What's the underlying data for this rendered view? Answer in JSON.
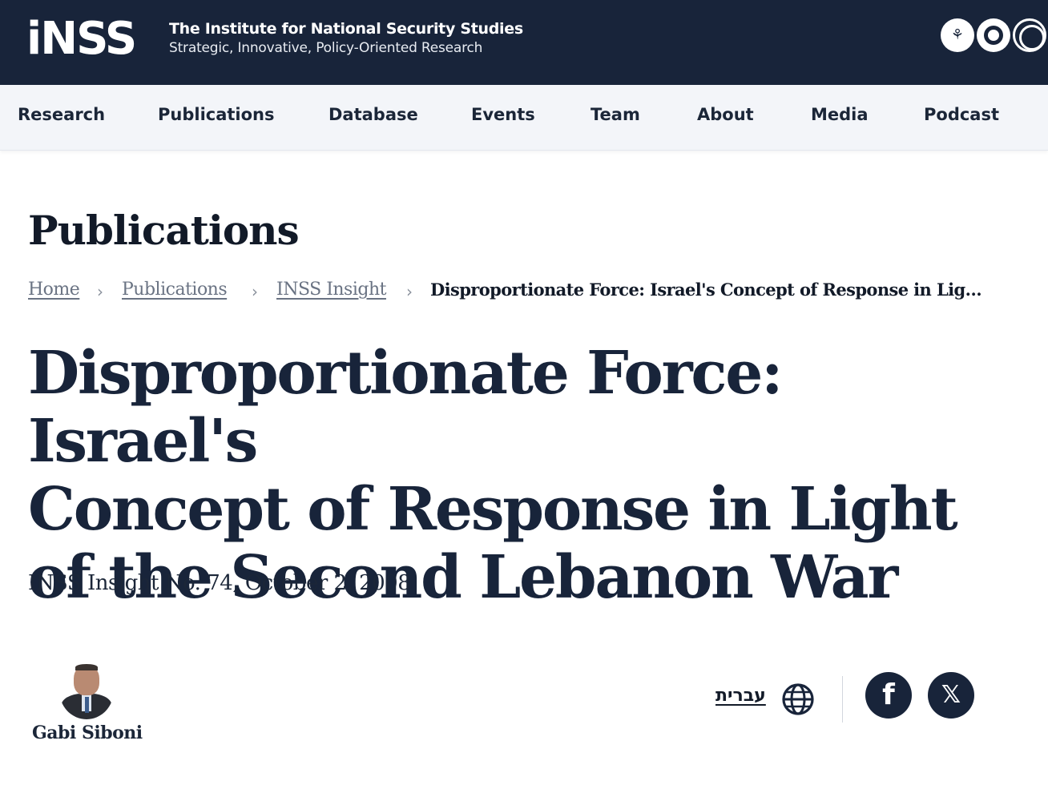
{
  "header": {
    "logo_text": "iNSS",
    "org_name": "The Institute for National Security Studies",
    "tagline": "Strategic, Innovative, Policy-Oriented Research",
    "partner_logo_glyph": "⚘"
  },
  "nav": {
    "items": [
      {
        "label": "Research"
      },
      {
        "label": "Publications"
      },
      {
        "label": "Database"
      },
      {
        "label": "Events"
      },
      {
        "label": "Team"
      },
      {
        "label": "About"
      },
      {
        "label": "Media"
      },
      {
        "label": "Podcast"
      }
    ]
  },
  "page": {
    "section_title": "Publications",
    "breadcrumb": {
      "items": [
        {
          "label": "Home"
        },
        {
          "label": "Publications"
        },
        {
          "label": "INSS Insight"
        }
      ],
      "separator": "›",
      "current": "Disproportionate Force: Israel's Concept of Response in Light of the Second Lebanon War"
    },
    "article": {
      "title_line1": "Disproportionate Force: Israel's",
      "title_line2": "Concept of Response in Light",
      "title_line3": "of the Second Lebanon War",
      "meta": "INSS Insight No. 74, October 2, 2008"
    },
    "author": {
      "name": "Gabi Siboni"
    },
    "language_link": "עברית",
    "share": {
      "facebook_glyph": "f",
      "x_glyph": "𝕏"
    }
  },
  "colors": {
    "header_bg": "#18243a",
    "nav_bg": "#f3f5f9",
    "title_color": "#18243a"
  }
}
